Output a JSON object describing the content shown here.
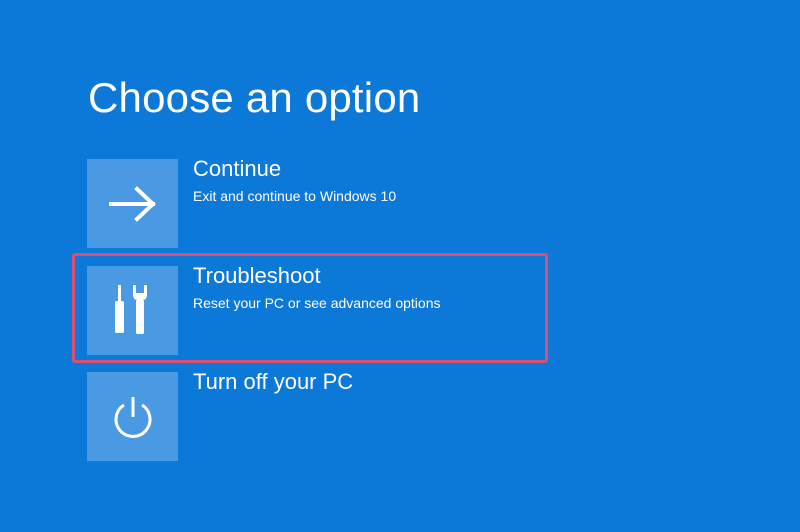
{
  "page": {
    "title": "Choose an option"
  },
  "options": [
    {
      "title": "Continue",
      "description": "Exit and continue to Windows 10",
      "icon": "arrow-right-icon"
    },
    {
      "title": "Troubleshoot",
      "description": "Reset your PC or see advanced options",
      "icon": "tools-icon",
      "highlighted": true
    },
    {
      "title": "Turn off your PC",
      "description": "",
      "icon": "power-icon"
    }
  ],
  "colors": {
    "background": "#0c79d9",
    "tile": "#4a9ae3",
    "highlight_border": "#d94f73",
    "text": "#ffffff"
  }
}
